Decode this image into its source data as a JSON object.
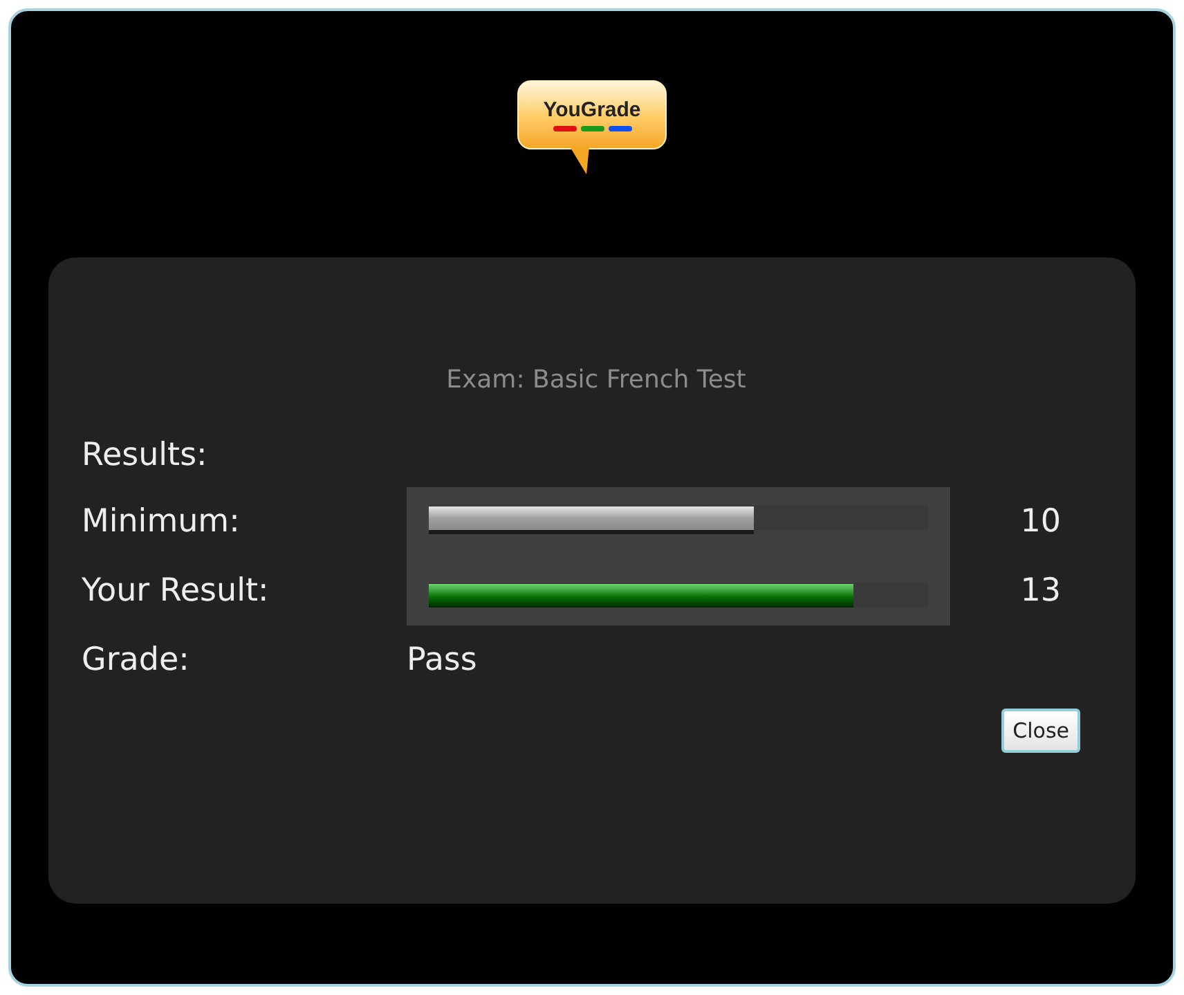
{
  "logo": {
    "text": "YouGrade"
  },
  "exam_title": "Exam: Basic French Test",
  "results_heading": "Results:",
  "bars": [
    {
      "label": "Minimum:",
      "kind": "minimum",
      "level": 0.65,
      "value": "10"
    },
    {
      "label": "Your Result:",
      "kind": "result",
      "level": 0.85,
      "value": "13"
    }
  ],
  "grade": {
    "label": "Grade:",
    "value": "Pass"
  },
  "buttons": [
    {
      "label": "Close"
    }
  ]
}
